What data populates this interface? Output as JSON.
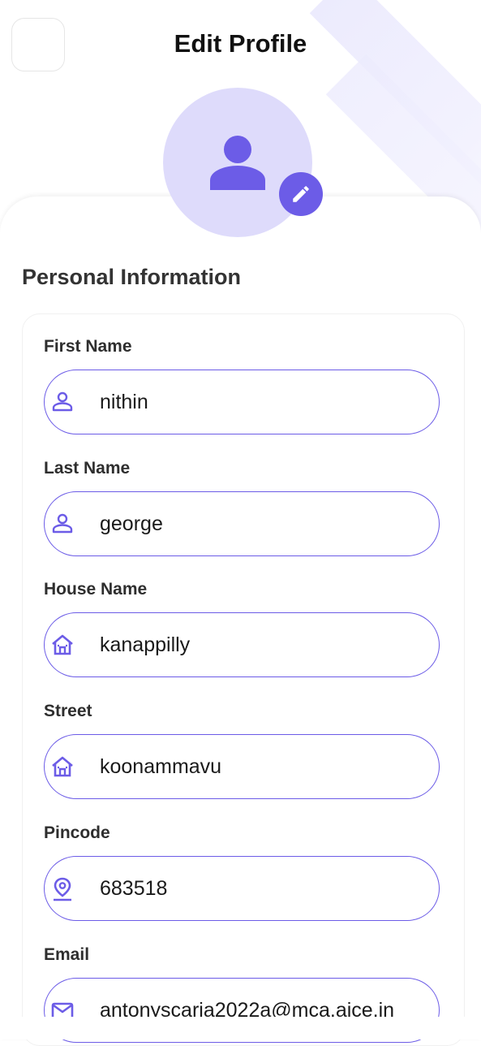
{
  "header": {
    "title": "Edit Profile"
  },
  "section": {
    "title": "Personal Information"
  },
  "colors": {
    "accent": "#6c5ce7",
    "avatar_bg": "#dedbfb"
  },
  "fields": [
    {
      "label": "First Name",
      "value": "nithin",
      "icon": "person-icon"
    },
    {
      "label": "Last Name",
      "value": "george",
      "icon": "person-icon"
    },
    {
      "label": "House Name",
      "value": "kanappilly",
      "icon": "house-icon"
    },
    {
      "label": "Street",
      "value": "koonammavu",
      "icon": "house-icon"
    },
    {
      "label": "Pincode",
      "value": "683518",
      "icon": "location-pin-icon"
    },
    {
      "label": "Email",
      "value": "antonyscaria2022a@mca.ajce.in",
      "icon": "mail-icon"
    }
  ]
}
